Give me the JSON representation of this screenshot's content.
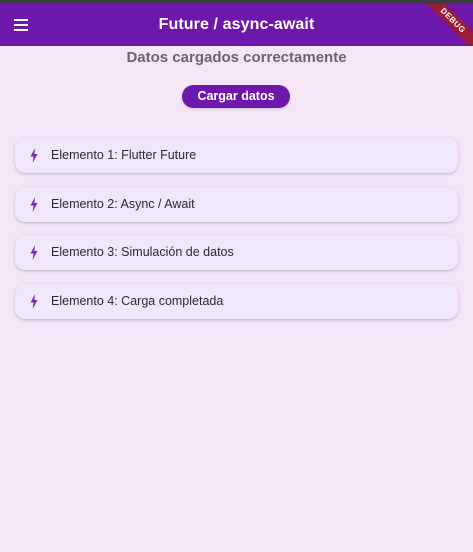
{
  "app_bar": {
    "title": "Future / async-await",
    "debug_label": "DEBUG",
    "menu_icon": "hamburger-menu-icon",
    "color": "#6d17ad"
  },
  "status": {
    "message": "Datos cargados correctamente"
  },
  "load_button": {
    "label": "Cargar datos"
  },
  "items": [
    {
      "label": "Elemento 1: Flutter Future",
      "icon": "lightning-bolt-icon"
    },
    {
      "label": "Elemento 2: Async / Await",
      "icon": "lightning-bolt-icon"
    },
    {
      "label": "Elemento 3: Simulación de datos",
      "icon": "lightning-bolt-icon"
    },
    {
      "label": "Elemento 4: Carga completada",
      "icon": "lightning-bolt-icon"
    }
  ],
  "colors": {
    "background": "#f4e6f6",
    "accent": "#6d17ad",
    "card": "#f0e7f8",
    "icon": "#6b2fb0"
  }
}
